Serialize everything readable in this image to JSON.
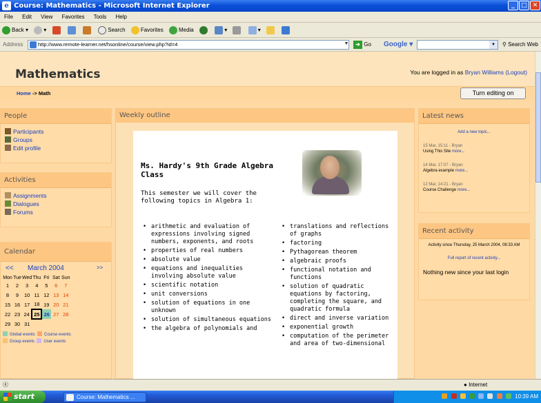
{
  "window": {
    "title": "Course: Mathematics - Microsoft Internet Explorer"
  },
  "menu": [
    "File",
    "Edit",
    "View",
    "Favorites",
    "Tools",
    "Help"
  ],
  "toolbar": {
    "back": "Back",
    "search": "Search",
    "favorites": "Favorites",
    "media": "Media"
  },
  "address": {
    "label": "Address",
    "url": "http://www.remote-learner.net/hsonline/course/view.php?id=4",
    "go": "Go",
    "google": "Google",
    "search_web": "Search Web"
  },
  "header": {
    "site_title": "Mathematics",
    "logged_in_prefix": "You are logged in as ",
    "user": "Bryan Williams",
    "logout": "(Logout)"
  },
  "nav": {
    "home": "Home",
    "separator": " -> ",
    "current": "Math",
    "edit_button": "Turn editing on"
  },
  "people": {
    "title": "People",
    "items": [
      "Participants",
      "Groups",
      "Edit profile"
    ]
  },
  "activities": {
    "title": "Activities",
    "items": [
      "Assignments",
      "Dialogues",
      "Forums"
    ]
  },
  "calendar": {
    "title": "Calendar",
    "prev": "<<",
    "next": ">>",
    "month": "March 2004",
    "days": [
      "Mon",
      "Tue",
      "Wed",
      "Thu",
      "Fri",
      "Sat",
      "Sun"
    ],
    "weeks": [
      [
        "1",
        "2",
        "3",
        "4",
        "5",
        "6",
        "7"
      ],
      [
        "8",
        "9",
        "10",
        "11",
        "12",
        "13",
        "14"
      ],
      [
        "15",
        "16",
        "17",
        "18",
        "19",
        "20",
        "21"
      ],
      [
        "22",
        "23",
        "24",
        "25",
        "26",
        "27",
        "28"
      ],
      [
        "29",
        "30",
        "31",
        "",
        "",
        "",
        ""
      ]
    ],
    "legend": [
      "Global events",
      "Course events",
      "Group events",
      "User events"
    ]
  },
  "main": {
    "title": "Weekly outline",
    "heading": "Ms. Hardy's 9th Grade Algebra Class",
    "intro": "This semester we will cover the following topics in Algebra 1:",
    "left_topics": [
      "arithmetic and evaluation of expressions involving signed numbers, exponents, and roots",
      "properties of real numbers",
      "absolute value",
      "equations and inequalities involving absolute value",
      "scientific notation",
      "unit conversions",
      "solution of equations in one unknown",
      "solution of simultaneous equations",
      "the algebra of polynomials and"
    ],
    "right_topics": [
      "translations and reflections of graphs",
      "factoring",
      "Pythagorean theorem",
      "algebraic proofs",
      "functional notation and functions",
      "solution of quadratic equations by factoring, completing the square, and quadratic formula",
      "direct and inverse variation",
      "exponential growth",
      "computation of the perimeter and area of two-dimensional"
    ]
  },
  "news": {
    "title": "Latest news",
    "add": "Add a new topic...",
    "items": [
      {
        "meta": "15 Mar, 15:11 - Bryan",
        "text": "Using This Site",
        "more": "more..."
      },
      {
        "meta": "14 Mar, 17:07 - Bryan",
        "text": "Algebra example",
        "more": "more..."
      },
      {
        "meta": "12 Mar, 14:21 - Bryan",
        "text": "Course Challenge",
        "more": "more..."
      }
    ]
  },
  "recent": {
    "title": "Recent activity",
    "since": "Activity since Thursday, 25 March 2004, 08:33 AM",
    "full_report": "Full report of recent activity...",
    "nothing": "Nothing new since your last login"
  },
  "statusbar": {
    "zone": "Internet"
  },
  "taskbar": {
    "start": "start",
    "item": "Course: Mathematics ...",
    "clock": "10:39 AM"
  }
}
